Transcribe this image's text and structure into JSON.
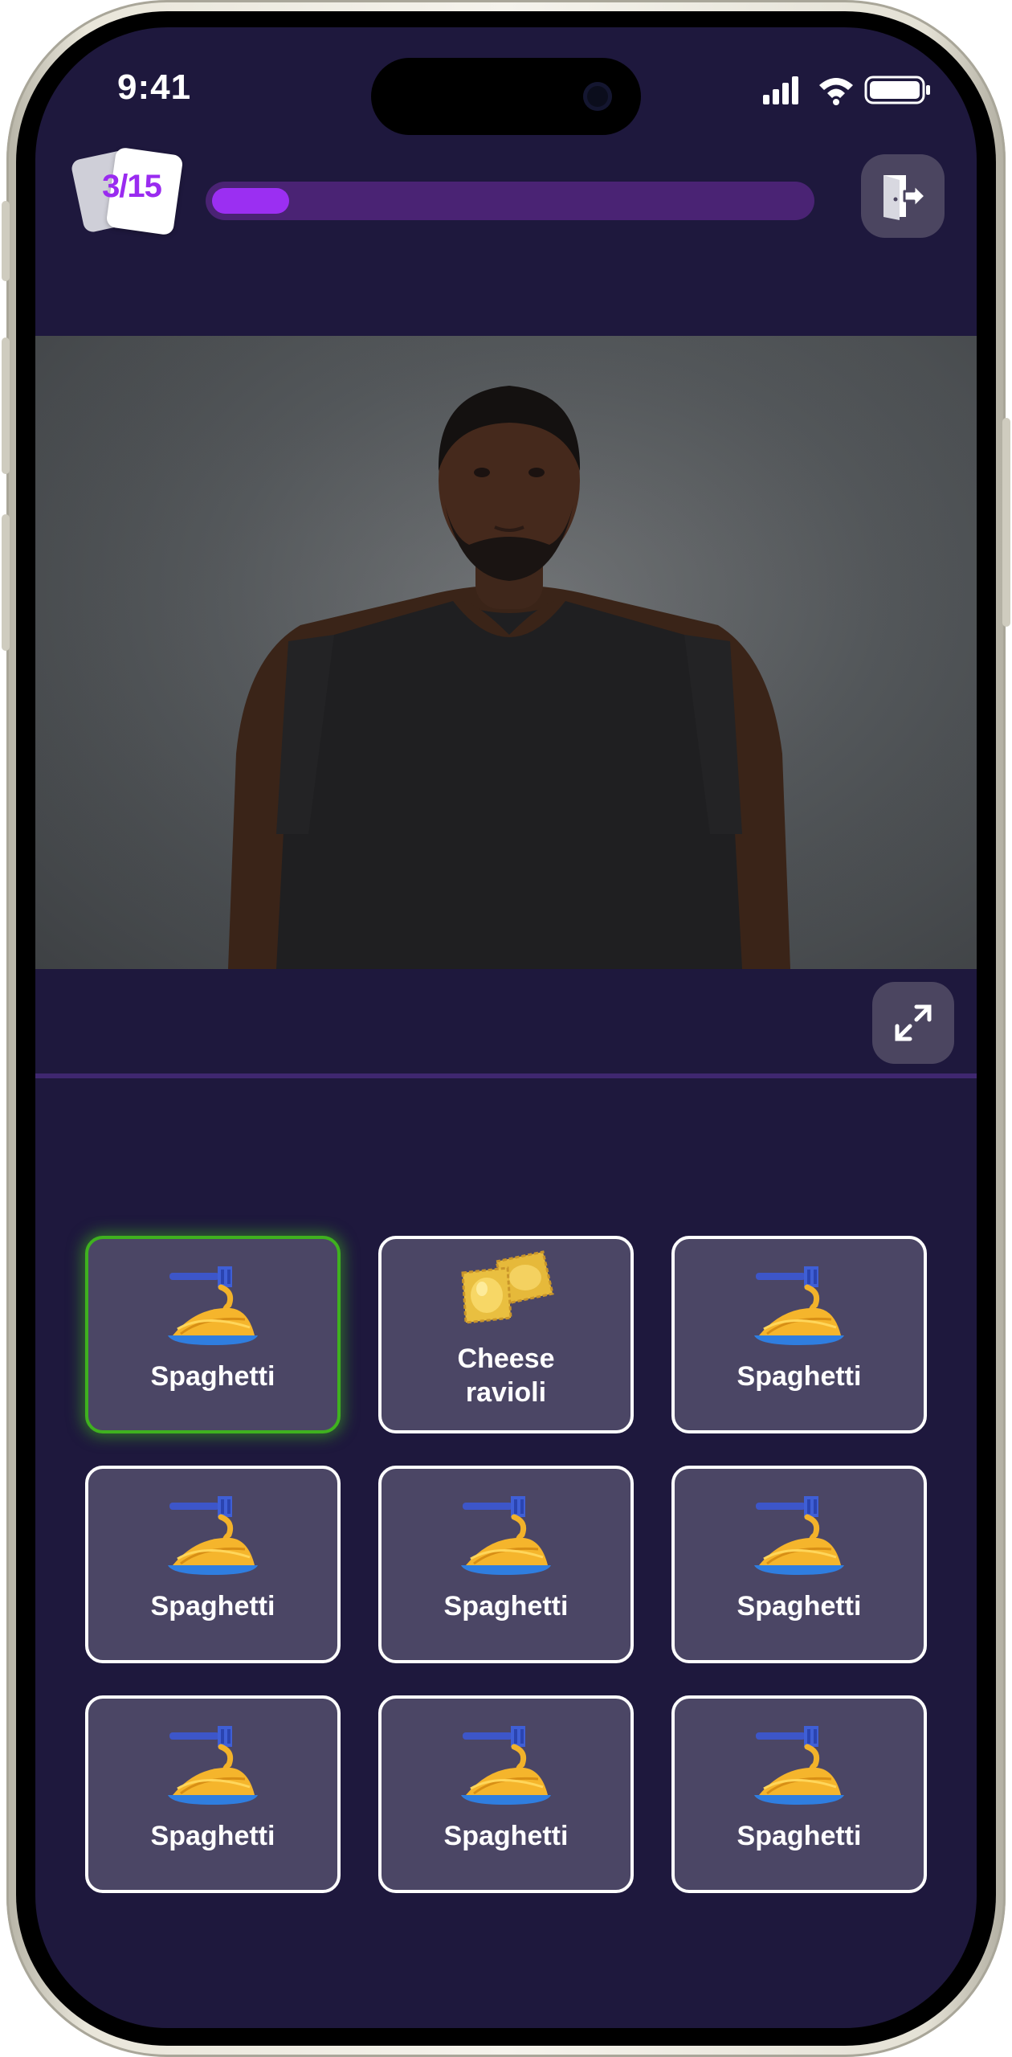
{
  "status_bar": {
    "time": "9:41"
  },
  "header": {
    "counter": "3/15",
    "progress": 0.13
  },
  "media": {
    "description": "sign language video"
  },
  "options": [
    {
      "label": "Spaghetti",
      "icon": "spaghetti-icon",
      "selected": true
    },
    {
      "label": "Cheese ravioli",
      "icon": "ravioli-icon",
      "selected": false
    },
    {
      "label": "Spaghetti",
      "icon": "spaghetti-icon",
      "selected": false
    },
    {
      "label": "Spaghetti",
      "icon": "spaghetti-icon",
      "selected": false
    },
    {
      "label": "Spaghetti",
      "icon": "spaghetti-icon",
      "selected": false
    },
    {
      "label": "Spaghetti",
      "icon": "spaghetti-icon",
      "selected": false
    },
    {
      "label": "Spaghetti",
      "icon": "spaghetti-icon",
      "selected": false
    },
    {
      "label": "Spaghetti",
      "icon": "spaghetti-icon",
      "selected": false
    },
    {
      "label": "Spaghetti",
      "icon": "spaghetti-icon",
      "selected": false
    }
  ],
  "colors": {
    "background": "#1e183d",
    "accent": "#9b2ff2",
    "selected_border": "#3fb11f",
    "tile": "#4b4665"
  }
}
